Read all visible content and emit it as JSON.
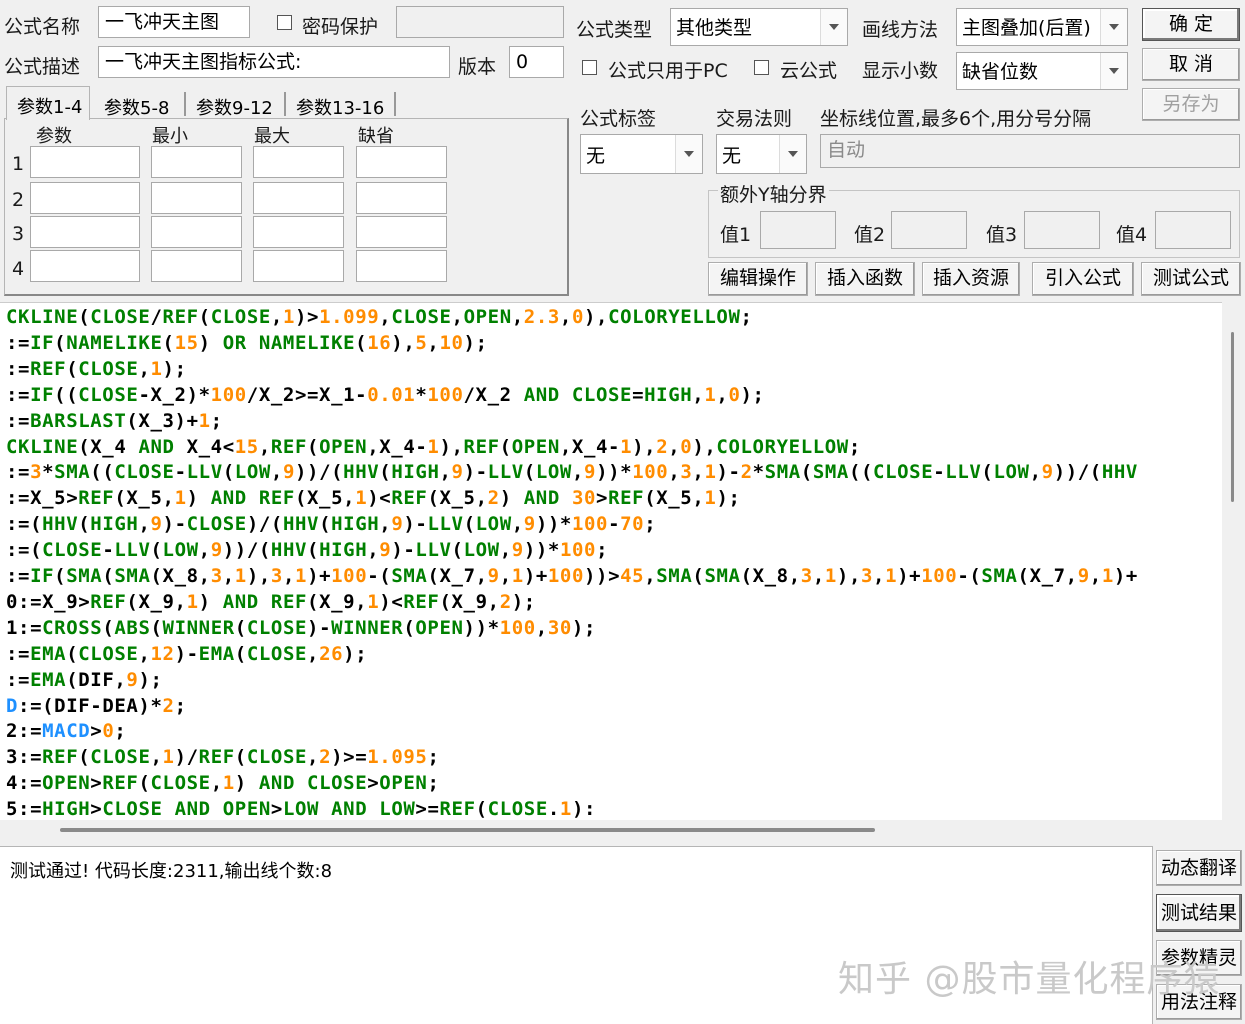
{
  "form": {
    "name_label": "公式名称",
    "name_value": "一飞冲天主图",
    "password_label": "密码保护",
    "desc_label": "公式描述",
    "desc_value": "一飞冲天主图指标公式:",
    "version_label": "版本",
    "version_value": "0",
    "type_label": "公式类型",
    "type_value": "其他类型",
    "draw_label": "画线方法",
    "draw_value": "主图叠加(后置)",
    "pc_only_label": "公式只用于PC",
    "cloud_label": "云公式",
    "decimal_label": "显示小数",
    "decimal_value": "缺省位数",
    "tag_label": "公式标签",
    "tag_value": "无",
    "rule_label": "交易法则",
    "rule_value": "无",
    "coord_label": "坐标线位置,最多6个,用分号分隔",
    "coord_placeholder": "自动",
    "extra_y_label": "额外Y轴分界",
    "val1_label": "值1",
    "val2_label": "值2",
    "val3_label": "值3",
    "val4_label": "值4"
  },
  "buttons": {
    "ok": "确  定",
    "cancel": "取  消",
    "save_as": "另存为",
    "edit": "编辑操作",
    "insert_func": "插入函数",
    "insert_res": "插入资源",
    "import": "引入公式",
    "test": "测试公式",
    "dyn_translate": "动态翻译",
    "test_result": "测试结果",
    "param_wizard": "参数精灵",
    "usage_note": "用法注释"
  },
  "param_tabs": [
    "参数1-4",
    "参数5-8",
    "参数9-12",
    "参数13-16"
  ],
  "param_headers": [
    "参数",
    "最小",
    "最大",
    "缺省"
  ],
  "param_rows": [
    "1",
    "2",
    "3",
    "4"
  ],
  "code_lines": [
    [
      [
        "g",
        "CKLINE"
      ],
      [
        "k",
        "("
      ],
      [
        "g",
        "CLOSE"
      ],
      [
        "k",
        "/"
      ],
      [
        "g",
        "REF"
      ],
      [
        "k",
        "("
      ],
      [
        "g",
        "CLOSE"
      ],
      [
        "k",
        ","
      ],
      [
        "o",
        "1"
      ],
      [
        "k",
        ")>"
      ],
      [
        "o",
        "1.099"
      ],
      [
        "k",
        ","
      ],
      [
        "g",
        "CLOSE"
      ],
      [
        "k",
        ","
      ],
      [
        "g",
        "OPEN"
      ],
      [
        "k",
        ","
      ],
      [
        "o",
        "2.3"
      ],
      [
        "k",
        ","
      ],
      [
        "o",
        "0"
      ],
      [
        "k",
        "),"
      ],
      [
        "g",
        "COLORYELLOW"
      ],
      [
        "k",
        ";"
      ]
    ],
    [
      [
        "k",
        ":="
      ],
      [
        "g",
        "IF"
      ],
      [
        "k",
        "("
      ],
      [
        "g",
        "NAMELIKE"
      ],
      [
        "k",
        "("
      ],
      [
        "o",
        "15"
      ],
      [
        "k",
        ") "
      ],
      [
        "g",
        "OR"
      ],
      [
        "k",
        " "
      ],
      [
        "g",
        "NAMELIKE"
      ],
      [
        "k",
        "("
      ],
      [
        "o",
        "16"
      ],
      [
        "k",
        "),"
      ],
      [
        "o",
        "5"
      ],
      [
        "k",
        ","
      ],
      [
        "o",
        "10"
      ],
      [
        "k",
        ");"
      ]
    ],
    [
      [
        "k",
        ":="
      ],
      [
        "g",
        "REF"
      ],
      [
        "k",
        "("
      ],
      [
        "g",
        "CLOSE"
      ],
      [
        "k",
        ","
      ],
      [
        "o",
        "1"
      ],
      [
        "k",
        ");"
      ]
    ],
    [
      [
        "k",
        ":="
      ],
      [
        "g",
        "IF"
      ],
      [
        "k",
        "(("
      ],
      [
        "g",
        "CLOSE"
      ],
      [
        "k",
        "-X_2)*"
      ],
      [
        "o",
        "100"
      ],
      [
        "k",
        "/X_2>=X_1-"
      ],
      [
        "o",
        "0.01"
      ],
      [
        "k",
        "*"
      ],
      [
        "o",
        "100"
      ],
      [
        "k",
        "/X_2 "
      ],
      [
        "g",
        "AND"
      ],
      [
        "k",
        " "
      ],
      [
        "g",
        "CLOSE"
      ],
      [
        "k",
        "="
      ],
      [
        "g",
        "HIGH"
      ],
      [
        "k",
        ","
      ],
      [
        "o",
        "1"
      ],
      [
        "k",
        ","
      ],
      [
        "o",
        "0"
      ],
      [
        "k",
        ");"
      ]
    ],
    [
      [
        "k",
        ":="
      ],
      [
        "g",
        "BARSLAST"
      ],
      [
        "k",
        "(X_3)+"
      ],
      [
        "o",
        "1"
      ],
      [
        "k",
        ";"
      ]
    ],
    [
      [
        "g",
        "CKLINE"
      ],
      [
        "k",
        "(X_4 "
      ],
      [
        "g",
        "AND"
      ],
      [
        "k",
        " X_4<"
      ],
      [
        "o",
        "15"
      ],
      [
        "k",
        ","
      ],
      [
        "g",
        "REF"
      ],
      [
        "k",
        "("
      ],
      [
        "g",
        "OPEN"
      ],
      [
        "k",
        ",X_4-"
      ],
      [
        "o",
        "1"
      ],
      [
        "k",
        "),"
      ],
      [
        "g",
        "REF"
      ],
      [
        "k",
        "("
      ],
      [
        "g",
        "OPEN"
      ],
      [
        "k",
        ",X_4-"
      ],
      [
        "o",
        "1"
      ],
      [
        "k",
        "),"
      ],
      [
        "o",
        "2"
      ],
      [
        "k",
        ","
      ],
      [
        "o",
        "0"
      ],
      [
        "k",
        "),"
      ],
      [
        "g",
        "COLORYELLOW"
      ],
      [
        "k",
        ";"
      ]
    ],
    [
      [
        "k",
        ":="
      ],
      [
        "o",
        "3"
      ],
      [
        "k",
        "*"
      ],
      [
        "g",
        "SMA"
      ],
      [
        "k",
        "(("
      ],
      [
        "g",
        "CLOSE"
      ],
      [
        "k",
        "-"
      ],
      [
        "g",
        "LLV"
      ],
      [
        "k",
        "("
      ],
      [
        "g",
        "LOW"
      ],
      [
        "k",
        ","
      ],
      [
        "o",
        "9"
      ],
      [
        "k",
        "))/("
      ],
      [
        "g",
        "HHV"
      ],
      [
        "k",
        "("
      ],
      [
        "g",
        "HIGH"
      ],
      [
        "k",
        ","
      ],
      [
        "o",
        "9"
      ],
      [
        "k",
        ")-"
      ],
      [
        "g",
        "LLV"
      ],
      [
        "k",
        "("
      ],
      [
        "g",
        "LOW"
      ],
      [
        "k",
        ","
      ],
      [
        "o",
        "9"
      ],
      [
        "k",
        "))*"
      ],
      [
        "o",
        "100"
      ],
      [
        "k",
        ","
      ],
      [
        "o",
        "3"
      ],
      [
        "k",
        ","
      ],
      [
        "o",
        "1"
      ],
      [
        "k",
        ")-"
      ],
      [
        "o",
        "2"
      ],
      [
        "k",
        "*"
      ],
      [
        "g",
        "SMA"
      ],
      [
        "k",
        "("
      ],
      [
        "g",
        "SMA"
      ],
      [
        "k",
        "(("
      ],
      [
        "g",
        "CLOSE"
      ],
      [
        "k",
        "-"
      ],
      [
        "g",
        "LLV"
      ],
      [
        "k",
        "("
      ],
      [
        "g",
        "LOW"
      ],
      [
        "k",
        ","
      ],
      [
        "o",
        "9"
      ],
      [
        "k",
        "))/("
      ],
      [
        "g",
        "HHV"
      ]
    ],
    [
      [
        "k",
        ":=X_5>"
      ],
      [
        "g",
        "REF"
      ],
      [
        "k",
        "(X_5,"
      ],
      [
        "o",
        "1"
      ],
      [
        "k",
        ") "
      ],
      [
        "g",
        "AND"
      ],
      [
        "k",
        " "
      ],
      [
        "g",
        "REF"
      ],
      [
        "k",
        "(X_5,"
      ],
      [
        "o",
        "1"
      ],
      [
        "k",
        ")<"
      ],
      [
        "g",
        "REF"
      ],
      [
        "k",
        "(X_5,"
      ],
      [
        "o",
        "2"
      ],
      [
        "k",
        ") "
      ],
      [
        "g",
        "AND"
      ],
      [
        "k",
        " "
      ],
      [
        "o",
        "30"
      ],
      [
        "k",
        ">"
      ],
      [
        "g",
        "REF"
      ],
      [
        "k",
        "(X_5,"
      ],
      [
        "o",
        "1"
      ],
      [
        "k",
        ");"
      ]
    ],
    [
      [
        "k",
        ":=("
      ],
      [
        "g",
        "HHV"
      ],
      [
        "k",
        "("
      ],
      [
        "g",
        "HIGH"
      ],
      [
        "k",
        ","
      ],
      [
        "o",
        "9"
      ],
      [
        "k",
        ")-"
      ],
      [
        "g",
        "CLOSE"
      ],
      [
        "k",
        ")/("
      ],
      [
        "g",
        "HHV"
      ],
      [
        "k",
        "("
      ],
      [
        "g",
        "HIGH"
      ],
      [
        "k",
        ","
      ],
      [
        "o",
        "9"
      ],
      [
        "k",
        ")-"
      ],
      [
        "g",
        "LLV"
      ],
      [
        "k",
        "("
      ],
      [
        "g",
        "LOW"
      ],
      [
        "k",
        ","
      ],
      [
        "o",
        "9"
      ],
      [
        "k",
        "))*"
      ],
      [
        "o",
        "100"
      ],
      [
        "k",
        "-"
      ],
      [
        "o",
        "70"
      ],
      [
        "k",
        ";"
      ]
    ],
    [
      [
        "k",
        ":=("
      ],
      [
        "g",
        "CLOSE"
      ],
      [
        "k",
        "-"
      ],
      [
        "g",
        "LLV"
      ],
      [
        "k",
        "("
      ],
      [
        "g",
        "LOW"
      ],
      [
        "k",
        ","
      ],
      [
        "o",
        "9"
      ],
      [
        "k",
        "))/("
      ],
      [
        "g",
        "HHV"
      ],
      [
        "k",
        "("
      ],
      [
        "g",
        "HIGH"
      ],
      [
        "k",
        ","
      ],
      [
        "o",
        "9"
      ],
      [
        "k",
        ")-"
      ],
      [
        "g",
        "LLV"
      ],
      [
        "k",
        "("
      ],
      [
        "g",
        "LOW"
      ],
      [
        "k",
        ","
      ],
      [
        "o",
        "9"
      ],
      [
        "k",
        "))*"
      ],
      [
        "o",
        "100"
      ],
      [
        "k",
        ";"
      ]
    ],
    [
      [
        "k",
        ":="
      ],
      [
        "g",
        "IF"
      ],
      [
        "k",
        "("
      ],
      [
        "g",
        "SMA"
      ],
      [
        "k",
        "("
      ],
      [
        "g",
        "SMA"
      ],
      [
        "k",
        "(X_8,"
      ],
      [
        "o",
        "3"
      ],
      [
        "k",
        ","
      ],
      [
        "o",
        "1"
      ],
      [
        "k",
        "),"
      ],
      [
        "o",
        "3"
      ],
      [
        "k",
        ","
      ],
      [
        "o",
        "1"
      ],
      [
        "k",
        ")+"
      ],
      [
        "o",
        "100"
      ],
      [
        "k",
        "-("
      ],
      [
        "g",
        "SMA"
      ],
      [
        "k",
        "(X_7,"
      ],
      [
        "o",
        "9"
      ],
      [
        "k",
        ","
      ],
      [
        "o",
        "1"
      ],
      [
        "k",
        ")+"
      ],
      [
        "o",
        "100"
      ],
      [
        "k",
        "))>"
      ],
      [
        "o",
        "45"
      ],
      [
        "k",
        ","
      ],
      [
        "g",
        "SMA"
      ],
      [
        "k",
        "("
      ],
      [
        "g",
        "SMA"
      ],
      [
        "k",
        "(X_8,"
      ],
      [
        "o",
        "3"
      ],
      [
        "k",
        ","
      ],
      [
        "o",
        "1"
      ],
      [
        "k",
        "),"
      ],
      [
        "o",
        "3"
      ],
      [
        "k",
        ","
      ],
      [
        "o",
        "1"
      ],
      [
        "k",
        ")+"
      ],
      [
        "o",
        "100"
      ],
      [
        "k",
        "-("
      ],
      [
        "g",
        "SMA"
      ],
      [
        "k",
        "(X_7,"
      ],
      [
        "o",
        "9"
      ],
      [
        "k",
        ","
      ],
      [
        "o",
        "1"
      ],
      [
        "k",
        ")+"
      ]
    ],
    [
      [
        "k",
        "0:=X_9>"
      ],
      [
        "g",
        "REF"
      ],
      [
        "k",
        "(X_9,"
      ],
      [
        "o",
        "1"
      ],
      [
        "k",
        ") "
      ],
      [
        "g",
        "AND"
      ],
      [
        "k",
        " "
      ],
      [
        "g",
        "REF"
      ],
      [
        "k",
        "(X_9,"
      ],
      [
        "o",
        "1"
      ],
      [
        "k",
        ")<"
      ],
      [
        "g",
        "REF"
      ],
      [
        "k",
        "(X_9,"
      ],
      [
        "o",
        "2"
      ],
      [
        "k",
        ");"
      ]
    ],
    [
      [
        "k",
        "1:="
      ],
      [
        "g",
        "CROSS"
      ],
      [
        "k",
        "("
      ],
      [
        "g",
        "ABS"
      ],
      [
        "k",
        "("
      ],
      [
        "g",
        "WINNER"
      ],
      [
        "k",
        "("
      ],
      [
        "g",
        "CLOSE"
      ],
      [
        "k",
        ")-"
      ],
      [
        "g",
        "WINNER"
      ],
      [
        "k",
        "("
      ],
      [
        "g",
        "OPEN"
      ],
      [
        "k",
        "))*"
      ],
      [
        "o",
        "100"
      ],
      [
        "k",
        ","
      ],
      [
        "o",
        "30"
      ],
      [
        "k",
        ");"
      ]
    ],
    [
      [
        "k",
        ":="
      ],
      [
        "g",
        "EMA"
      ],
      [
        "k",
        "("
      ],
      [
        "g",
        "CLOSE"
      ],
      [
        "k",
        ","
      ],
      [
        "o",
        "12"
      ],
      [
        "k",
        ")-"
      ],
      [
        "g",
        "EMA"
      ],
      [
        "k",
        "("
      ],
      [
        "g",
        "CLOSE"
      ],
      [
        "k",
        ","
      ],
      [
        "o",
        "26"
      ],
      [
        "k",
        ");"
      ]
    ],
    [
      [
        "k",
        ":="
      ],
      [
        "g",
        "EMA"
      ],
      [
        "k",
        "(DIF,"
      ],
      [
        "o",
        "9"
      ],
      [
        "k",
        ");"
      ]
    ],
    [
      [
        "b",
        "D"
      ],
      [
        "k",
        ":=(DIF-DEA)*"
      ],
      [
        "o",
        "2"
      ],
      [
        "k",
        ";"
      ]
    ],
    [
      [
        "k",
        "2:="
      ],
      [
        "b",
        "MACD"
      ],
      [
        "k",
        ">"
      ],
      [
        "o",
        "0"
      ],
      [
        "k",
        ";"
      ]
    ],
    [
      [
        "k",
        "3:="
      ],
      [
        "g",
        "REF"
      ],
      [
        "k",
        "("
      ],
      [
        "g",
        "CLOSE"
      ],
      [
        "k",
        ","
      ],
      [
        "o",
        "1"
      ],
      [
        "k",
        ")/"
      ],
      [
        "g",
        "REF"
      ],
      [
        "k",
        "("
      ],
      [
        "g",
        "CLOSE"
      ],
      [
        "k",
        ","
      ],
      [
        "o",
        "2"
      ],
      [
        "k",
        ")>="
      ],
      [
        "o",
        "1.095"
      ],
      [
        "k",
        ";"
      ]
    ],
    [
      [
        "k",
        "4:="
      ],
      [
        "g",
        "OPEN"
      ],
      [
        "k",
        ">"
      ],
      [
        "g",
        "REF"
      ],
      [
        "k",
        "("
      ],
      [
        "g",
        "CLOSE"
      ],
      [
        "k",
        ","
      ],
      [
        "o",
        "1"
      ],
      [
        "k",
        ") "
      ],
      [
        "g",
        "AND"
      ],
      [
        "k",
        " "
      ],
      [
        "g",
        "CLOSE"
      ],
      [
        "k",
        ">"
      ],
      [
        "g",
        "OPEN"
      ],
      [
        "k",
        ";"
      ]
    ],
    [
      [
        "k",
        "5:="
      ],
      [
        "g",
        "HIGH"
      ],
      [
        "k",
        ">"
      ],
      [
        "g",
        "CLOSE"
      ],
      [
        "k",
        " "
      ],
      [
        "g",
        "AND"
      ],
      [
        "k",
        " "
      ],
      [
        "g",
        "OPEN"
      ],
      [
        "k",
        ">"
      ],
      [
        "g",
        "LOW"
      ],
      [
        "k",
        " "
      ],
      [
        "g",
        "AND"
      ],
      [
        "k",
        " "
      ],
      [
        "g",
        "LOW"
      ],
      [
        "k",
        ">="
      ],
      [
        "g",
        "REF"
      ],
      [
        "k",
        "("
      ],
      [
        "g",
        "CLOSE"
      ],
      [
        "k",
        "."
      ],
      [
        "o",
        "1"
      ],
      [
        "k",
        "):"
      ]
    ]
  ],
  "output_text": "测试通过! 代码长度:2311,输出线个数:8",
  "watermark": "知乎 @股市量化程序猿"
}
